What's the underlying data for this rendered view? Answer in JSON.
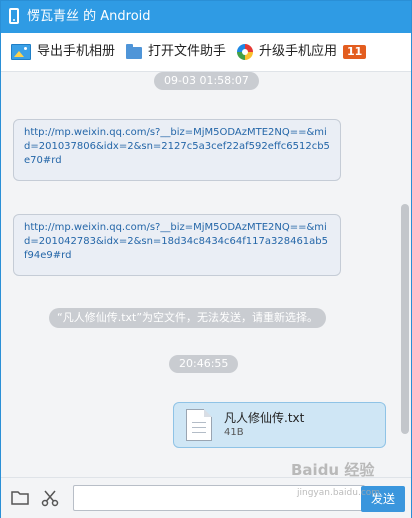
{
  "window": {
    "title": "愣瓦青丝 的 Android"
  },
  "toolbar": {
    "export_photos_label": "导出手机相册",
    "open_file_helper_label": "打开文件助手",
    "upgrade_apps_label": "升级手机应用",
    "upgrade_badge": "11"
  },
  "chat": {
    "top_timestamp": "09-03 01:58:07",
    "messages": [
      {
        "text": "http://mp.weixin.qq.com/s?__biz=MjM5ODAzMTE2NQ==&mid=201037806&idx=2&sn=2127c5a3cef22af592effc6512cb5e70#rd"
      },
      {
        "text": "http://mp.weixin.qq.com/s?__biz=MjM5ODAzMTE2NQ==&mid=201042783&idx=2&sn=18d34c8434c64f117a328461ab5f94e9#rd"
      }
    ],
    "notice": "“凡人修仙传.txt”为空文件，无法发送，请重新选择。",
    "time_label": "20:46:55",
    "file": {
      "name": "凡人修仙传.txt",
      "size": "41B"
    }
  },
  "inputbar": {
    "send_label": "发送",
    "input_placeholder": ""
  },
  "watermark": {
    "text": "Baidu 经验",
    "url": "jingyan.baidu.com"
  },
  "colors": {
    "titlebar": "#2f9be4",
    "accent": "#3a96dd",
    "badge": "#e35d1f"
  }
}
